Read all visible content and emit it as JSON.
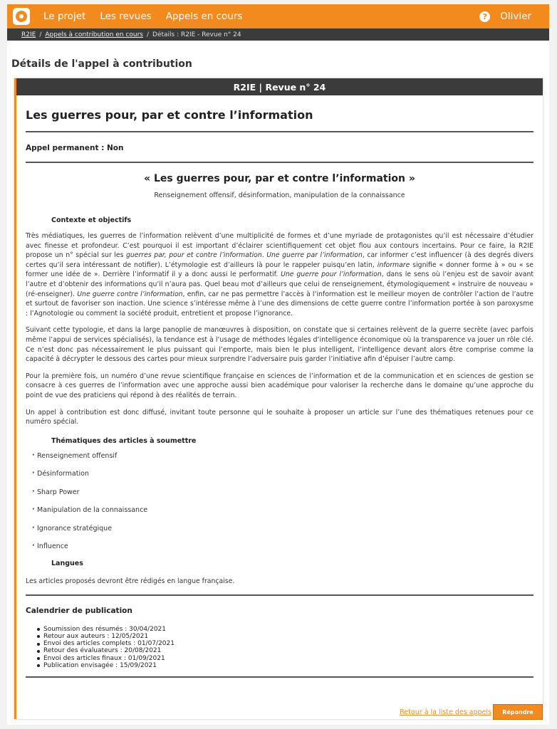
{
  "nav": {
    "links": [
      "Le projet",
      "Les revues",
      "Appels en cours"
    ],
    "user": "Olivier",
    "help_icon": "question-circle-icon",
    "accent": "#f28a1e",
    "dark": "#3b3b3b"
  },
  "breadcrumb": {
    "home": "R2IE",
    "appels": "Appels à contribution en cours",
    "current": "Détails : R2IE - Revue n° 24"
  },
  "page_heading": "Détails de l'appel à contribution",
  "panel": {
    "header": "R2IE | Revue n° 24",
    "title": "Les guerres pour, par et contre l’information",
    "permanent": "Appel permanent : Non",
    "quote_title": "« Les guerres pour, par et contre l’information »",
    "subtitle": "Renseignement offensif, désinformation, manipulation de la connaissance",
    "context_head": "Contexte et objectifs",
    "p1_parts": [
      "Très médiatiques, les guerres de l’information relèvent d’une multiplicité de formes et d’une myriade de protagonistes qu’il est nécessaire d’étudier avec finesse et profondeur. C’est pourquoi il est important d’éclairer scientifiquement cet objet flou aux contours incertains. Pour ce faire, la R2IE propose un n° spécial sur les ",
      "guerres par, pour et contre l’information",
      ". ",
      "Une guerre par l’information",
      ", car informer c’est influencer (à des degrés divers certes qu’il sera intéressant de notifier). L’étymologie est d’ailleurs là pour le rappeler puisqu’en latin, ",
      "informare",
      " signifie « donner forme à » ou « se former une idée de ». Derrière l’informatif il y a donc aussi le performatif. ",
      "Une guerre pour l’information",
      ", dans le sens où l’enjeu est de savoir avant l’autre et d’obtenir des informations qu’il n’aura pas. Quel beau mot d’ailleurs que celui de renseignement, étymologiquement « instruire de nouveau » (ré-enseigner). ",
      "Une guerre contre l’information",
      ", enfin, car ne pas permettre l’accès à l’information est le meilleur moyen de contrôler l’action de l’autre et surtout de favoriser son inaction. Une science s’intéresse même à l’une des dimensions de cette guerre contre l’information portée à son paroxysme : l’Agnotologie ou comment la société produit, entretient et propose l’ignorance."
    ],
    "p2": "Suivant cette typologie, et dans la large panoplie de manœuvres à disposition, on constate que si certaines relèvent de la guerre secrète (avec parfois même l’appui de services spécialisés), la tendance est à l’usage de méthodes légales d’intelligence économique où la transparence va jouer un rôle clé. Ce n’est donc pas nécessairement le plus puissant qui l’emporte, mais bien le plus intelligent, l’intelligence devant alors être comprise comme la capacité à décrypter le dessous des cartes pour mieux surprendre l’adversaire puis garder l’initiative afin d’épuiser l’autre camp.",
    "p3": "Pour la première fois, un numéro d’une revue scientifique française en sciences de l’information et de la communication et en sciences de gestion se consacre à ces guerres de l’information avec une approche aussi bien académique pour valoriser la recherche dans le domaine qu’une approche du point de vue des praticiens qui répond à des réalités de terrain.",
    "p4": "Un appel à contribution est donc diffusé, invitant toute personne qui le souhaite à proposer un article sur l’une des thématiques retenues pour ce numéro spécial.",
    "themes_head": "Thématiques des articles à soumettre",
    "themes": [
      "Renseignement offensif",
      "Désinformation",
      "Sharp Power",
      "Manipulation de la connaissance",
      "Ignorance stratégique",
      "Influence"
    ],
    "lang_head": "Langues",
    "lang_text": "Les articles proposés devront être rédigés en langue française.",
    "cal_head": "Calendrier de publication",
    "calendar": [
      "Soumission des résumés : 30/04/2021",
      "Retour aux auteurs : 12/05/2021",
      "Envoi des articles complets : 01/07/2021",
      "Retour des évaluateurs : 20/08/2021",
      "Envoi des articles finaux : 01/09/2021",
      "Publication envisagée : 15/09/2021"
    ],
    "back_link": "Retour à la liste des appels",
    "reply_button": "Répondre"
  }
}
